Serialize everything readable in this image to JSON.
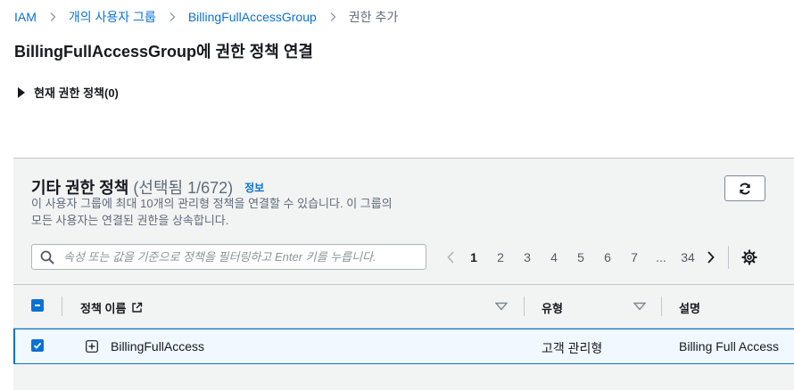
{
  "breadcrumb": {
    "items": [
      "IAM",
      "개의 사용자 그룹",
      "BillingFullAccessGroup"
    ],
    "current": "권한 추가"
  },
  "page": {
    "title": "BillingFullAccessGroup에 권한 정책 연결"
  },
  "current_policies": {
    "label": "현재 권한 정책(0)",
    "expanded": false
  },
  "other_policies": {
    "title": "기타 권한 정책",
    "count": "(선택됨 1/672)",
    "info_link": "정보",
    "description": "이 사용자 그룹에 최대 10개의 관리형 정책을 연결할 수 있습니다. 이 그룹의 모든 사용자는 연결된 권한을 상속합니다."
  },
  "search": {
    "placeholder": "속성 또는 값을 기준으로 정책을 필터링하고 Enter 키를 누릅니다.",
    "value": ""
  },
  "pagination": {
    "pages": [
      "1",
      "2",
      "3",
      "4",
      "5",
      "6",
      "7",
      "...",
      "34"
    ],
    "current": "1"
  },
  "table": {
    "columns": {
      "name": "정책 이름",
      "type": "유형",
      "description": "설명"
    },
    "rows": [
      {
        "selected": true,
        "name": "BillingFullAccess",
        "type": "고객 관리형",
        "description": "Billing Full Access"
      }
    ]
  },
  "colors": {
    "link": "#0972d3",
    "text": "#16191f",
    "muted": "#5f6b7a",
    "panel_bg": "#f2f3f3",
    "selected_row_bg": "#f1f8ff"
  },
  "icons": [
    "chevron-right-icon",
    "caret-right-icon",
    "refresh-icon",
    "search-icon",
    "chevron-left-icon",
    "settings-icon",
    "external-link-icon",
    "sort-down-icon",
    "expand-plus-icon",
    "checkbox-indeterminate-icon",
    "checkbox-checked-icon"
  ]
}
